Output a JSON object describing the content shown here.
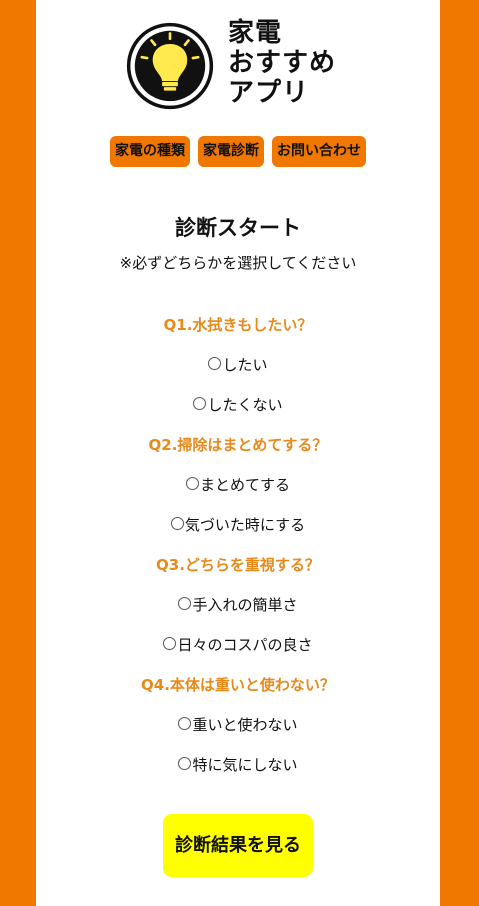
{
  "app": {
    "logo_lines": [
      "家電",
      "おすすめ",
      "アプリ"
    ],
    "logo_icon": "lightbulb-icon"
  },
  "nav": {
    "items": [
      {
        "label": "家電の種類"
      },
      {
        "label": "家電診断"
      },
      {
        "label": "お問い合わせ"
      }
    ]
  },
  "main": {
    "title": "診断スタート",
    "note": "※必ずどちらかを選択してください",
    "questions": [
      {
        "label": "Q1.水拭きもしたい？",
        "options": [
          "したい",
          "したくない"
        ]
      },
      {
        "label": "Q2.掃除はまとめてする？",
        "options": [
          "まとめてする",
          "気づいた時にする"
        ]
      },
      {
        "label": "Q3.どちらを重視する？",
        "options": [
          "手入れの簡単さ",
          "日々のコスパの良さ"
        ]
      },
      {
        "label": "Q4.本体は重いと使わない？",
        "options": [
          "重いと使わない",
          "特に気にしない"
        ]
      }
    ],
    "submit_label": "診断結果を見る"
  },
  "colors": {
    "accent": "#f07800",
    "question_text": "#e88a1a",
    "submit_bg": "#ffff00",
    "panel_bg": "#ffffff"
  }
}
